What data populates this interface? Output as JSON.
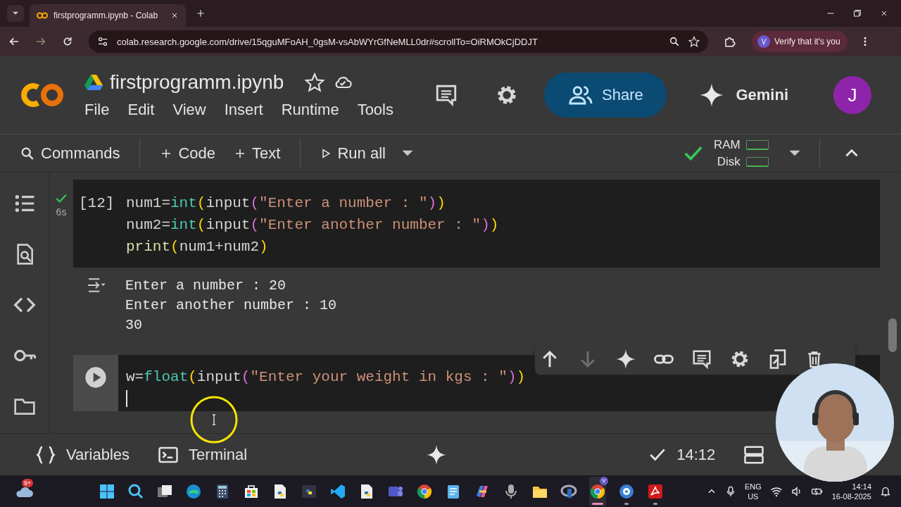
{
  "browser": {
    "tab_title": "firstprogramm.ipynb - Colab",
    "url": "colab.research.google.com/drive/15qguMFoAH_0gsM-vsAbWYrGfNeMLL0dr#scrollTo=OiRMOkCjDDJT",
    "profile_letter": "V",
    "profile_label": "Verify that it's you"
  },
  "notebook": {
    "title": "firstprogramm.ipynb",
    "starred": false,
    "menu": [
      "File",
      "Edit",
      "View",
      "Insert",
      "Runtime",
      "Tools"
    ],
    "share_label": "Share",
    "gemini_label": "Gemini",
    "avatar_letter": "J"
  },
  "toolbar": {
    "commands": "Commands",
    "add_code": "Code",
    "add_text": "Text",
    "run_all": "Run all",
    "connected": true,
    "ram_label": "RAM",
    "disk_label": "Disk"
  },
  "cells": [
    {
      "kind": "code",
      "execution_count": "[12]",
      "succeeded": true,
      "elapsed": "6s",
      "focused": false,
      "lines": [
        [
          {
            "kind": "plain",
            "text": "num1="
          },
          {
            "kind": "builtin",
            "text": "int"
          },
          {
            "kind": "paren1",
            "text": "("
          },
          {
            "kind": "plain",
            "text": "input"
          },
          {
            "kind": "paren2",
            "text": "("
          },
          {
            "kind": "string",
            "text": "\"Enter a number : \""
          },
          {
            "kind": "paren2",
            "text": ")"
          },
          {
            "kind": "paren1",
            "text": ")"
          }
        ],
        [
          {
            "kind": "plain",
            "text": "num2="
          },
          {
            "kind": "builtin",
            "text": "int"
          },
          {
            "kind": "paren1",
            "text": "("
          },
          {
            "kind": "plain",
            "text": "input"
          },
          {
            "kind": "paren2",
            "text": "("
          },
          {
            "kind": "string",
            "text": "\"Enter another number : \""
          },
          {
            "kind": "paren2",
            "text": ")"
          },
          {
            "kind": "paren1",
            "text": ")"
          }
        ],
        [
          {
            "kind": "func",
            "text": "print"
          },
          {
            "kind": "paren1",
            "text": "("
          },
          {
            "kind": "plain",
            "text": "num1+num2"
          },
          {
            "kind": "paren1",
            "text": ")"
          }
        ]
      ],
      "output": [
        "Enter a number : 20",
        "Enter another number : 10",
        "30"
      ]
    },
    {
      "kind": "code",
      "succeeded": false,
      "focused": true,
      "caret_on_new_line": true,
      "lines": [
        [
          {
            "kind": "plain",
            "text": "w="
          },
          {
            "kind": "builtin",
            "text": "float"
          },
          {
            "kind": "paren1",
            "text": "("
          },
          {
            "kind": "plain",
            "text": "input"
          },
          {
            "kind": "paren2",
            "text": "("
          },
          {
            "kind": "string",
            "text": "\"Enter your weight in kgs : \""
          },
          {
            "kind": "paren2",
            "text": ")"
          },
          {
            "kind": "paren1",
            "text": ")"
          }
        ]
      ]
    }
  ],
  "cell_toolbar": {
    "move_down_disabled": true
  },
  "bottom_bar": {
    "variables": "Variables",
    "terminal": "Terminal",
    "status_time": "14:12"
  },
  "taskbar": {
    "weather_badge": "9+",
    "apps": [
      {
        "kind": "start",
        "running": false,
        "active": false
      },
      {
        "kind": "search",
        "running": false,
        "active": false
      },
      {
        "kind": "taskview",
        "running": false,
        "active": false
      },
      {
        "kind": "edge",
        "running": false,
        "active": false
      },
      {
        "kind": "calculator",
        "running": false,
        "active": false
      },
      {
        "kind": "store",
        "running": false,
        "active": false
      },
      {
        "kind": "pyfile",
        "running": false,
        "active": false
      },
      {
        "kind": "pyapp",
        "running": false,
        "active": false
      },
      {
        "kind": "vscode",
        "running": false,
        "active": false
      },
      {
        "kind": "pyfile",
        "running": false,
        "active": false
      },
      {
        "kind": "teams",
        "running": false,
        "active": false
      },
      {
        "kind": "chrome",
        "running": false,
        "active": false
      },
      {
        "kind": "notepad",
        "running": false,
        "active": false
      },
      {
        "kind": "copilot",
        "running": false,
        "active": false
      },
      {
        "kind": "mic",
        "running": false,
        "active": false
      },
      {
        "kind": "folder",
        "running": false,
        "active": false
      },
      {
        "kind": "ring",
        "running": false,
        "active": false
      },
      {
        "kind": "chrome",
        "badge": "V",
        "running": true,
        "active": true
      },
      {
        "kind": "bug",
        "running": true,
        "active": false
      },
      {
        "kind": "acrobat",
        "running": true,
        "active": false
      }
    ],
    "language": "ENG",
    "region": "US",
    "time": "14:14",
    "date": "16-08-2025"
  }
}
